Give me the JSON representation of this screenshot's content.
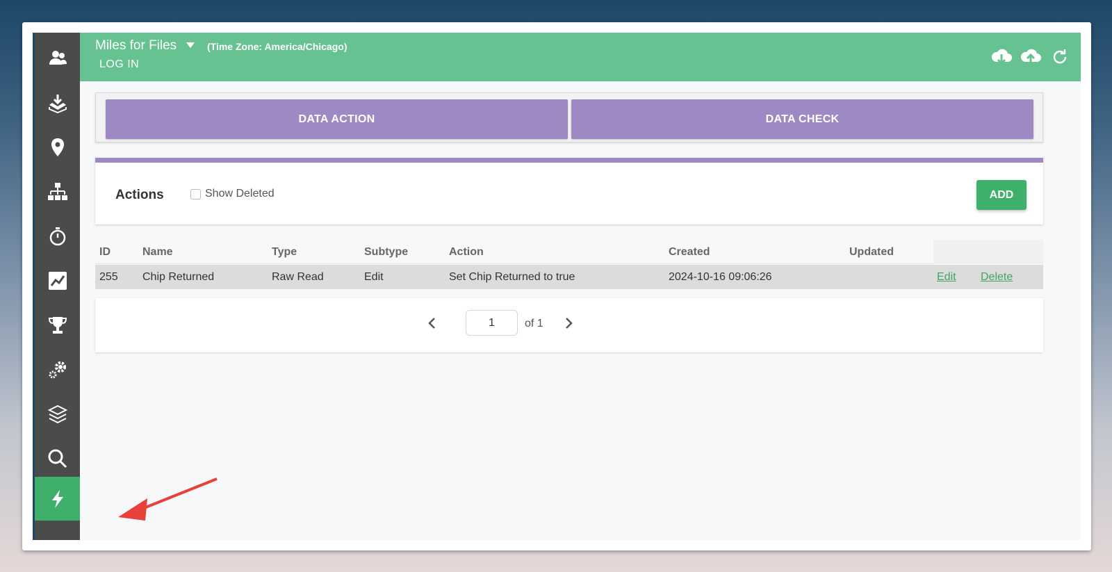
{
  "header": {
    "app_title": "Miles for Files",
    "time_zone": "(Time Zone: America/Chicago)",
    "login_label": "LOG IN"
  },
  "sidebar": {
    "items": [
      {
        "icon": "users-icon"
      },
      {
        "icon": "download-tray-icon"
      },
      {
        "icon": "map-pin-icon"
      },
      {
        "icon": "sitemap-icon"
      },
      {
        "icon": "stopwatch-icon"
      },
      {
        "icon": "chart-line-icon"
      },
      {
        "icon": "trophy-icon"
      },
      {
        "icon": "gears-icon"
      },
      {
        "icon": "layers-icon"
      },
      {
        "icon": "search-icon"
      },
      {
        "icon": "bolt-icon",
        "active": true
      }
    ]
  },
  "top_icons": [
    "cloud-download-icon",
    "cloud-upload-icon",
    "refresh-icon"
  ],
  "panel_buttons": {
    "data_action": "DATA ACTION",
    "data_check": "DATA CHECK"
  },
  "actions_card": {
    "title": "Actions",
    "show_deleted_label": "Show Deleted",
    "add_label": "ADD"
  },
  "table": {
    "columns": [
      "ID",
      "Name",
      "Type",
      "Subtype",
      "Action",
      "Created",
      "Updated"
    ],
    "rows": [
      {
        "id": "255",
        "name": "Chip Returned",
        "type": "Raw Read",
        "subtype": "Edit",
        "action": "Set Chip Returned to true",
        "created": "2024-10-16 09:06:26",
        "updated": "",
        "edit_label": "Edit",
        "delete_label": "Delete"
      }
    ]
  },
  "pager": {
    "page": "1",
    "of_label": "of 1"
  },
  "colors": {
    "header_green": "#66c291",
    "accent_green": "#3fb06b",
    "purple": "#9f89c4",
    "sidebar_dark": "#4a4c4b",
    "annotation_red": "#e8413c"
  }
}
